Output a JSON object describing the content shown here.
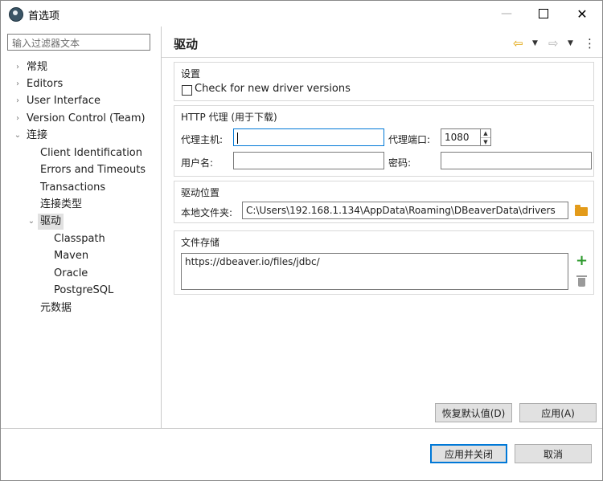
{
  "window": {
    "title": "首选项",
    "controls": {
      "minimize": "—",
      "close": "✕"
    }
  },
  "sidebar": {
    "filter_placeholder": "输入过滤器文本",
    "tree": [
      {
        "label": "常规",
        "expandable": true,
        "expanded": false
      },
      {
        "label": "Editors",
        "expandable": true,
        "expanded": false
      },
      {
        "label": "User Interface",
        "expandable": true,
        "expanded": false
      },
      {
        "label": "Version Control (Team)",
        "expandable": true,
        "expanded": false
      },
      {
        "label": "连接",
        "expandable": true,
        "expanded": true,
        "children": [
          {
            "label": "Client Identification"
          },
          {
            "label": "Errors and Timeouts"
          },
          {
            "label": "Transactions"
          },
          {
            "label": "连接类型"
          },
          {
            "label": "驱动",
            "expandable": true,
            "expanded": true,
            "selected": true,
            "children": [
              {
                "label": "Classpath"
              },
              {
                "label": "Maven"
              },
              {
                "label": "Oracle"
              },
              {
                "label": "PostgreSQL"
              }
            ]
          },
          {
            "label": "元数据"
          }
        ]
      }
    ],
    "arrows": {
      "collapsed": "›",
      "expanded": "⌄"
    }
  },
  "page": {
    "title": "驱动",
    "nav_icons": [
      "back-arrow-icon",
      "forward-arrow-icon",
      "menu-icon"
    ],
    "nav_glyphs": {
      "back": "⇦",
      "forward": "⇨",
      "dropdown": "▼",
      "menu": "⋮"
    }
  },
  "settings_group": {
    "title": "设置",
    "check_new_versions": {
      "label": "Check for new driver versions",
      "checked": false
    }
  },
  "proxy_group": {
    "title": "HTTP 代理 (用于下载)",
    "host_label": "代理主机:",
    "host_value": "",
    "port_label": "代理端口:",
    "port_value": "1080",
    "user_label": "用户名:",
    "user_value": "",
    "password_label": "密码:",
    "password_value": "",
    "spin_up": "▲",
    "spin_down": "▼"
  },
  "driver_location_group": {
    "title": "驱动位置",
    "local_folder_label": "本地文件夹:",
    "local_folder_value": "C:\\Users\\192.168.1.134\\AppData\\Roaming\\DBeaverData\\drivers"
  },
  "file_storage_group": {
    "title": "文件存储",
    "entries": [
      "https://dbeaver.io/files/jdbc/"
    ],
    "add_glyph": "+"
  },
  "buttons": {
    "restore_defaults": "恢复默认值(D)",
    "apply": "应用(A)",
    "apply_and_close": "应用并关闭",
    "cancel": "取消"
  },
  "colors": {
    "accent": "#0078d7",
    "folder": "#e39b1a",
    "add": "#2e9a2e",
    "back_arrow": "#e0a100"
  }
}
